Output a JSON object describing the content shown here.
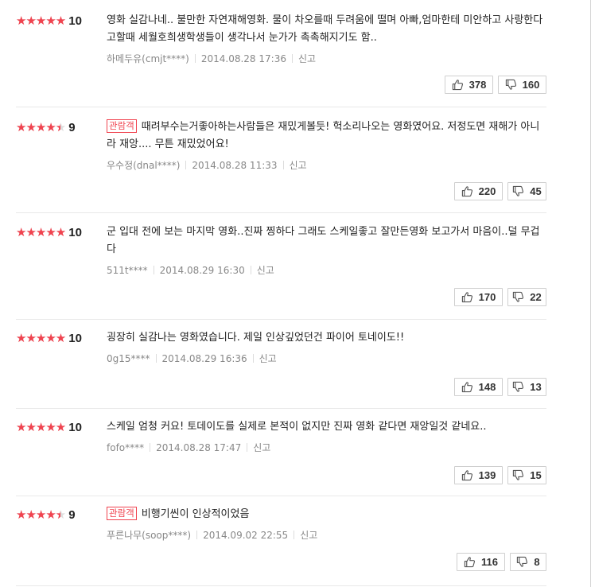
{
  "reviews": [
    {
      "rating": "10",
      "fill": 1.0,
      "badge": "",
      "text": "영화 실감나네.. 불만한 자연재해영화. 물이 차오를때 두려움에 떨며 아빠,엄마한테 미안하고 사랑한다고할때 세월호희생학생들이 생각나서 눈가가 촉촉해지기도 함..",
      "author": "하메두유(cmjt****)",
      "date": "2014.08.28 17:36",
      "report": "신고",
      "likes": "378",
      "dislikes": "160"
    },
    {
      "rating": "9",
      "fill": 0.9,
      "badge": "관람객",
      "text": "때려부수는거좋아하는사람들은 재밌게볼듯! 헉소리나오는 영화였어요. 저정도면 재해가 아니라 재앙.... 무튼 재밌었어요!",
      "author": "우수정(dnal****)",
      "date": "2014.08.28 11:33",
      "report": "신고",
      "likes": "220",
      "dislikes": "45"
    },
    {
      "rating": "10",
      "fill": 1.0,
      "badge": "",
      "text": "군 입대 전에 보는 마지막 영화..진짜 찡하다 그래도 스케일좋고 잘만든영화 보고가서 마음이..덜 무겁다",
      "author": "511t****",
      "date": "2014.08.29 16:30",
      "report": "신고",
      "likes": "170",
      "dislikes": "22"
    },
    {
      "rating": "10",
      "fill": 1.0,
      "badge": "",
      "text": "굉장히 실감나는 영화였습니다. 제일 인상깊었던건 파이어 토네이도!!",
      "author": "0g15****",
      "date": "2014.08.29 16:36",
      "report": "신고",
      "likes": "148",
      "dislikes": "13"
    },
    {
      "rating": "10",
      "fill": 1.0,
      "badge": "",
      "text": "스케일 엄청 커요! 토데이도를 실제로 본적이 없지만 진짜 영화 같다면 재앙일것 같네요..",
      "author": "fofo****",
      "date": "2014.08.28 17:47",
      "report": "신고",
      "likes": "139",
      "dislikes": "15"
    },
    {
      "rating": "9",
      "fill": 0.9,
      "badge": "관람객",
      "text": "비행기씬이 인상적이었음",
      "author": "푸른나무(soop****)",
      "date": "2014.09.02 22:55",
      "report": "신고",
      "likes": "116",
      "dislikes": "8"
    }
  ],
  "colors": {
    "star": "#f0434f",
    "badge": "#f0434f",
    "meta": "#888888"
  },
  "icons": {
    "like": "thumbs-up-icon",
    "dislike": "thumbs-down-icon",
    "star": "star-icon"
  }
}
